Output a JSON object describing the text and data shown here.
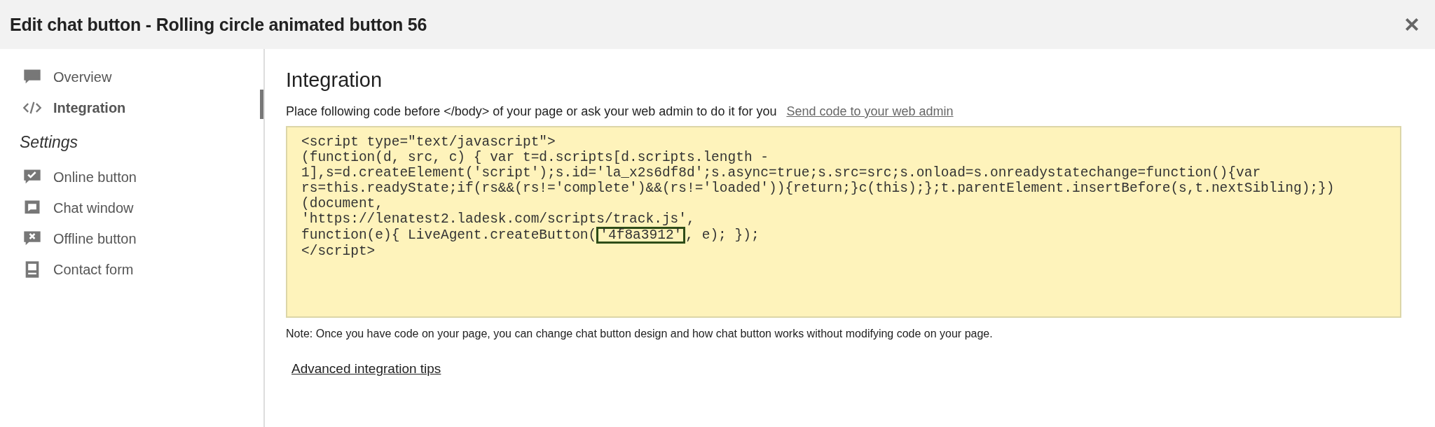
{
  "window": {
    "title": "Edit chat button - Rolling circle animated button 56"
  },
  "sidebar": {
    "items": [
      {
        "label": "Overview",
        "kind": "overview",
        "selected": false
      },
      {
        "label": "Integration",
        "kind": "code",
        "selected": true
      }
    ],
    "section_title": "Settings",
    "settings_items": [
      {
        "label": "Online button",
        "kind": "online",
        "selected": false
      },
      {
        "label": "Chat window",
        "kind": "window",
        "selected": false
      },
      {
        "label": "Offline button",
        "kind": "offline",
        "selected": false
      },
      {
        "label": "Contact form",
        "kind": "form",
        "selected": false
      }
    ]
  },
  "content": {
    "heading": "Integration",
    "instruction": "Place following code before </body> of your page or ask your web admin to do it for you",
    "send_link": "Send code to your web admin",
    "code_lines": [
      {
        "text": "<script type=\"text/javascript\">"
      },
      {
        "text": "(function(d, src, c) { var t=d.scripts[d.scripts.length -"
      },
      {
        "text": "1],s=d.createElement('script');s.id='la_x2s6df8d';s.async=true;s.src=src;s.onload=s.onreadystatechange=function(){var"
      },
      {
        "text": "rs=this.readyState;if(rs&&(rs!='complete')&&(rs!='loaded')){return;}c(this);};t.parentElement.insertBefore(s,t.nextSibling);})"
      },
      {
        "text": "(document,"
      },
      {
        "text": "'https://lenatest2.ladesk.com/scripts/track.js',"
      },
      {
        "text": "function(e){ LiveAgent.createButton(",
        "highlight": "'4f8a3912'",
        "after": ", e); });"
      },
      {
        "text": "</script>"
      }
    ],
    "note": "Note: Once you have code on your page, you can change chat button design and how chat button works without modifying code on your page.",
    "tips_link": "Advanced integration tips"
  }
}
